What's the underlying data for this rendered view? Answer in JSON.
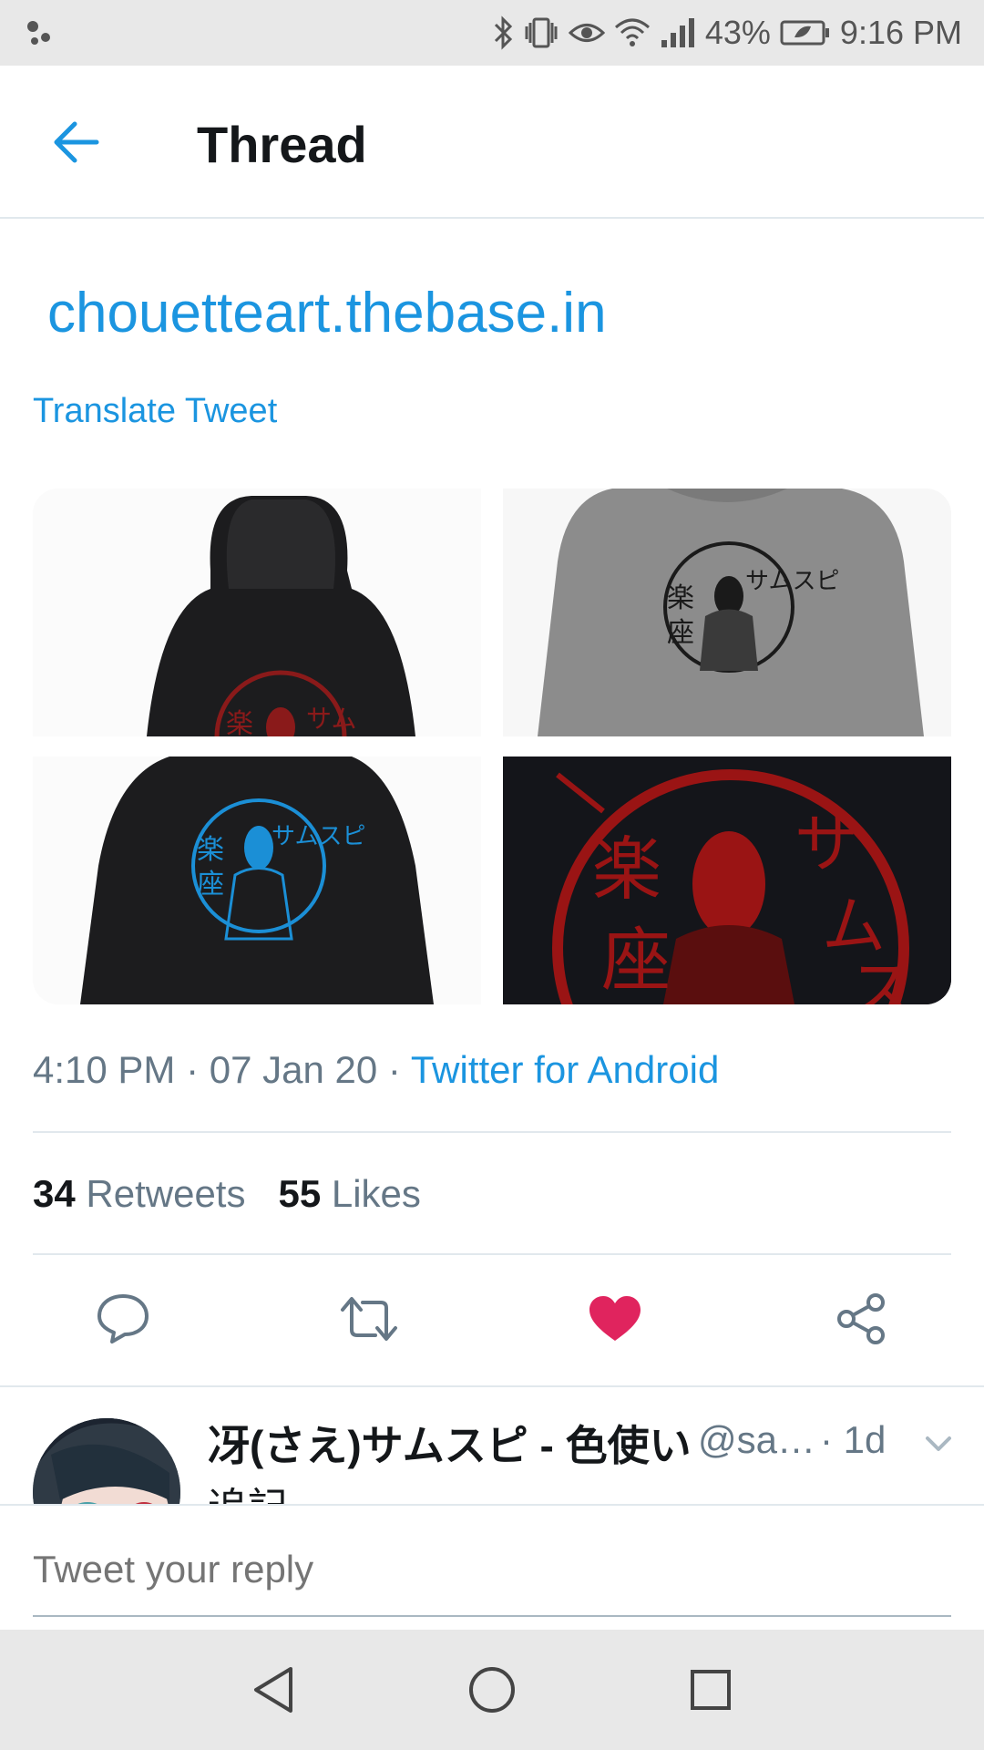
{
  "status_bar": {
    "battery": "43%",
    "time": "9:16 PM",
    "icons": [
      "assistant-dots-icon",
      "bluetooth-icon",
      "vibrate-icon",
      "eye-icon",
      "wifi-icon",
      "signal-icon",
      "battery-saver-icon"
    ]
  },
  "header": {
    "title": "Thread",
    "back_icon": "arrow-left-icon"
  },
  "tweet": {
    "link": "chouetteart.thebase.in",
    "translate": "Translate Tweet",
    "media": [
      {
        "name": "black-hoodie-red-print",
        "icon": "image"
      },
      {
        "name": "gray-sweatshirt-black-print",
        "icon": "image"
      },
      {
        "name": "black-hoodie-blue-print",
        "icon": "image"
      },
      {
        "name": "red-print-closeup",
        "icon": "image"
      }
    ],
    "time": "4:10 PM",
    "dot1": " · ",
    "date": "07 Jan 20",
    "dot2": " · ",
    "source": "Twitter for Android",
    "retweets_count": "34",
    "retweets_label": "Retweets",
    "likes_count": "55",
    "likes_label": "Likes",
    "actions": [
      "reply-icon",
      "retweet-icon",
      "like-icon",
      "share-icon"
    ],
    "colors": {
      "accent": "#1b95e0",
      "like": "#e0245e",
      "muted": "#657786"
    }
  },
  "reply": {
    "name": "冴(さえ)サムスピ - 色使い",
    "handle": "@sa…",
    "time": "· 1d",
    "text": "追記"
  },
  "compose": {
    "placeholder": "Tweet your reply"
  },
  "navbar": {
    "buttons": [
      "back-triangle-icon",
      "home-circle-icon",
      "recents-square-icon"
    ]
  }
}
